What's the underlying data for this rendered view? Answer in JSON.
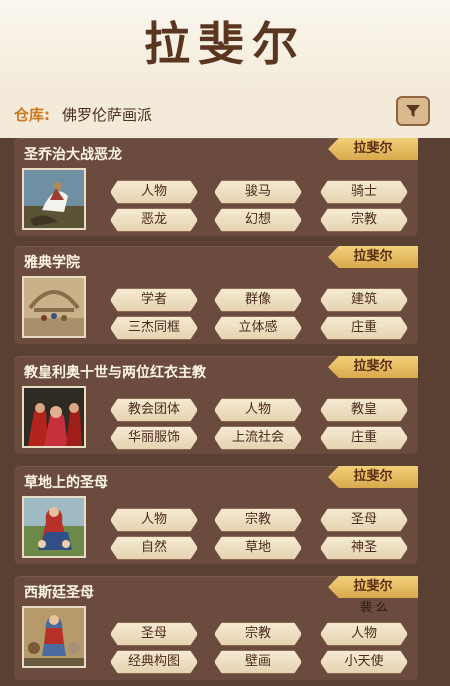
{
  "page": {
    "title": "拉斐尔"
  },
  "repo": {
    "label": "仓库:",
    "name": "佛罗伦萨画派"
  },
  "cards": [
    {
      "title": "圣乔治大战恶龙",
      "artist": "拉斐尔",
      "tags": [
        "人物",
        "骏马",
        "骑士",
        "恶龙",
        "幻想",
        "宗教"
      ]
    },
    {
      "title": "雅典学院",
      "artist": "拉斐尔",
      "tags": [
        "学者",
        "群像",
        "建筑",
        "三杰同框",
        "立体感",
        "庄重"
      ]
    },
    {
      "title": "教皇利奥十世与两位红衣主教",
      "artist": "拉斐尔",
      "tags": [
        "教会团体",
        "人物",
        "教皇",
        "华丽服饰",
        "上流社会",
        "庄重"
      ]
    },
    {
      "title": "草地上的圣母",
      "artist": "拉斐尔",
      "tags": [
        "人物",
        "宗教",
        "圣母",
        "自然",
        "草地",
        "神圣"
      ]
    },
    {
      "title": "西斯廷圣母",
      "artist": "拉斐尔",
      "tags": [
        "圣母",
        "宗教",
        "人物",
        "经典构图",
        "壁画",
        "小天使"
      ]
    }
  ],
  "overlay": {
    "text": "裴 么"
  },
  "icons": {
    "filter": "filter-icon"
  }
}
